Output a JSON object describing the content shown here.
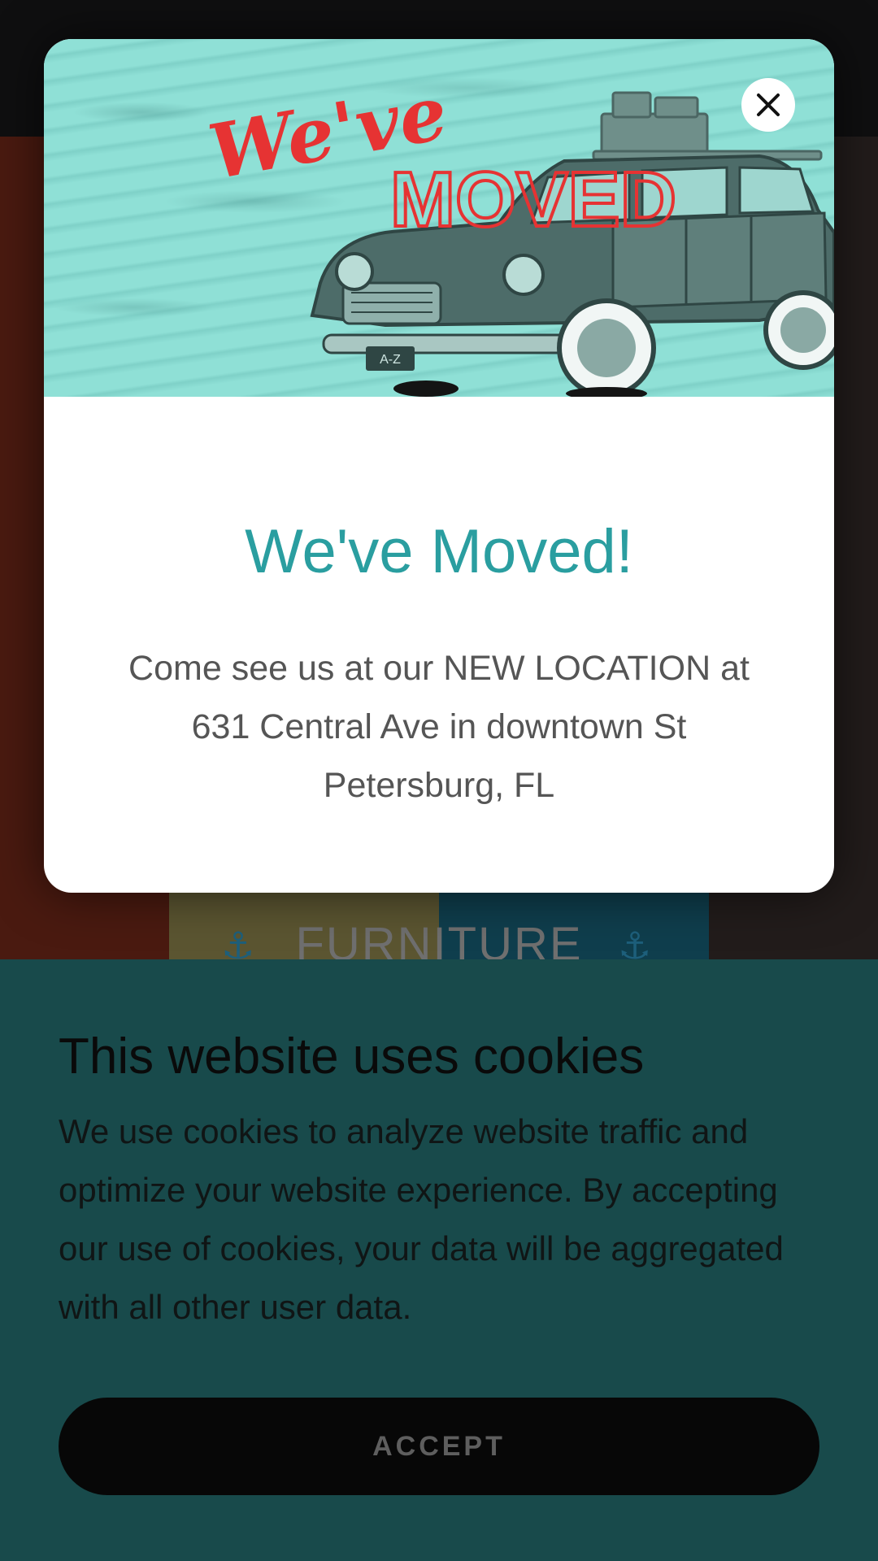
{
  "background": {
    "tile_text": "FURNITURE"
  },
  "modal": {
    "hero": {
      "script_text": "We've",
      "outline_text": "MOVED",
      "plate_text": "A-Z"
    },
    "close_icon": "close-icon",
    "title": "We've Moved!",
    "body": "Come see us at our NEW LOCATION at 631 Central Ave in downtown St Petersburg, FL",
    "colors": {
      "title": "#2a9ea0",
      "hero_bg": "#8fe0d6",
      "hero_script": "#e63333"
    }
  },
  "cookie_banner": {
    "title": "This website uses cookies",
    "body": "We use cookies to analyze website traffic and optimize your website experience. By accepting our use of cookies, your data will be aggregated with all other user data.",
    "accept_label": "ACCEPT",
    "colors": {
      "background": "#184a4b",
      "button": "#070707"
    }
  }
}
